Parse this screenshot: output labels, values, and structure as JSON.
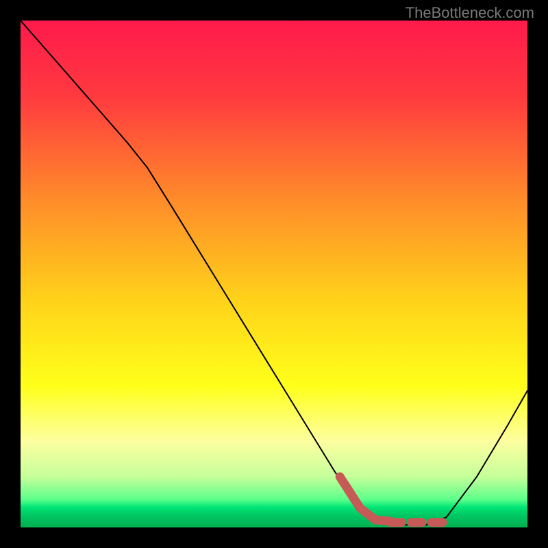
{
  "watermark": "TheBottleneck.com",
  "chart_data": {
    "type": "line",
    "title": "",
    "xlabel": "",
    "ylabel": "",
    "xlim": [
      0,
      100
    ],
    "ylim": [
      0,
      100
    ],
    "gradient_stops": [
      {
        "offset": 0.0,
        "color": "#ff1a4b"
      },
      {
        "offset": 0.15,
        "color": "#ff3a3f"
      },
      {
        "offset": 0.35,
        "color": "#ff8a2a"
      },
      {
        "offset": 0.55,
        "color": "#ffd21a"
      },
      {
        "offset": 0.72,
        "color": "#ffff1a"
      },
      {
        "offset": 0.83,
        "color": "#fdffa0"
      },
      {
        "offset": 0.9,
        "color": "#c5ff9a"
      },
      {
        "offset": 0.945,
        "color": "#5cff8a"
      },
      {
        "offset": 0.96,
        "color": "#00e676"
      },
      {
        "offset": 0.975,
        "color": "#00c864"
      },
      {
        "offset": 1.0,
        "color": "#00b050"
      }
    ],
    "series": [
      {
        "name": "bottleneck-curve-black",
        "stroke": "#000000",
        "stroke_width": 2,
        "points": [
          {
            "x": 0,
            "y": 100
          },
          {
            "x": 7,
            "y": 92
          },
          {
            "x": 14,
            "y": 84
          },
          {
            "x": 21,
            "y": 76
          },
          {
            "x": 25,
            "y": 71
          },
          {
            "x": 30,
            "y": 63
          },
          {
            "x": 38,
            "y": 50
          },
          {
            "x": 46,
            "y": 37
          },
          {
            "x": 54,
            "y": 24
          },
          {
            "x": 62,
            "y": 11
          },
          {
            "x": 66,
            "y": 5
          },
          {
            "x": 70,
            "y": 1.5
          },
          {
            "x": 75,
            "y": 0.5
          },
          {
            "x": 80,
            "y": 0.5
          },
          {
            "x": 84,
            "y": 2
          },
          {
            "x": 90,
            "y": 10
          },
          {
            "x": 96,
            "y": 20
          },
          {
            "x": 100,
            "y": 27
          }
        ]
      },
      {
        "name": "highlight-thick-red",
        "stroke": "#c55a57",
        "stroke_width": 13,
        "style": "solid",
        "points": [
          {
            "x": 63,
            "y": 10
          },
          {
            "x": 67,
            "y": 3.8
          },
          {
            "x": 70,
            "y": 1.5
          },
          {
            "x": 73,
            "y": 1.2
          }
        ]
      },
      {
        "name": "highlight-dashed-red",
        "stroke": "#c55a57",
        "stroke_width": 13,
        "style": "dashed",
        "points": [
          {
            "x": 73,
            "y": 1.0
          },
          {
            "x": 84,
            "y": 1.0
          }
        ]
      }
    ]
  }
}
